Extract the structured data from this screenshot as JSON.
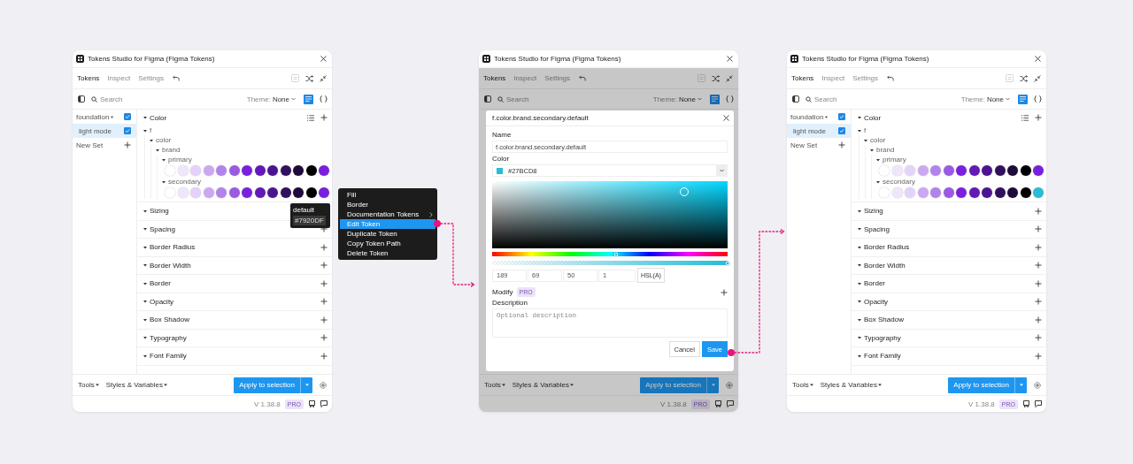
{
  "panels": [
    {
      "title": "Tokens Studio for Figma (Figma Tokens)",
      "dimmed": false,
      "tabs": [
        {
          "label": "Tokens",
          "selected": true
        },
        {
          "label": "Inspect",
          "selected": false
        },
        {
          "label": "Settings",
          "selected": false
        }
      ],
      "search": {
        "placeholder": "Search"
      },
      "theme": {
        "label": "Theme:",
        "value": "None"
      },
      "sets": [
        {
          "name": "foundation",
          "kind": "folder",
          "selected": false,
          "checked": true
        },
        {
          "name": "light mode",
          "kind": "set",
          "selected": true,
          "checked": true
        }
      ],
      "new_set": "New Set",
      "token_groups": [
        {
          "name": "Color",
          "tree": [
            {
              "name": "f",
              "children": [
                {
                  "name": "color",
                  "children": [
                    {
                      "name": "brand",
                      "children": [
                        {
                          "name": "primary",
                          "swatches": [
                            {
                              "color": "#ffffff"
                            },
                            {
                              "color": "#f0e6fc"
                            },
                            {
                              "color": "#e3d3f9"
                            },
                            {
                              "color": "#cca8f1"
                            },
                            {
                              "color": "#b283ea"
                            },
                            {
                              "color": "#9a5be2"
                            },
                            {
                              "color": "#7920df"
                            },
                            {
                              "color": "#6219b8"
                            },
                            {
                              "color": "#4c1590"
                            },
                            {
                              "color": "#32105e"
                            },
                            {
                              "color": "#1f0b3a"
                            },
                            {
                              "color": "#000000"
                            },
                            {
                              "color": "#7920df"
                            }
                          ]
                        },
                        {
                          "name": "secondary",
                          "swatches": [
                            {
                              "color": "#ffffff"
                            },
                            {
                              "color": "#f0e6fc"
                            },
                            {
                              "color": "#e3d3f9"
                            },
                            {
                              "color": "#cca8f1"
                            },
                            {
                              "color": "#b283ea"
                            },
                            {
                              "color": "#9a5be2"
                            },
                            {
                              "color": "#7920df"
                            },
                            {
                              "color": "#6219b8"
                            },
                            {
                              "color": "#4c1590"
                            },
                            {
                              "color": "#32105e"
                            },
                            {
                              "color": "#1f0b3a"
                            },
                            {
                              "color": "#000000"
                            },
                            {
                              "color": "#7920df"
                            }
                          ]
                        }
                      ]
                    }
                  ]
                }
              ]
            }
          ]
        },
        {
          "name": "Sizing"
        },
        {
          "name": "Spacing"
        },
        {
          "name": "Border Radius"
        },
        {
          "name": "Border Width"
        },
        {
          "name": "Border"
        },
        {
          "name": "Opacity"
        },
        {
          "name": "Box Shadow"
        },
        {
          "name": "Typography"
        },
        {
          "name": "Font Family"
        }
      ],
      "tooltip": {
        "title": "default",
        "value": "#7920DF"
      },
      "footer": {
        "menus": [
          "Tools",
          "Styles & Variables"
        ],
        "apply_button": "Apply to selection"
      },
      "status": {
        "version": "V 1.38.8",
        "badge": "PRO"
      }
    },
    {
      "title": "Tokens Studio for Figma (Figma Tokens)",
      "dimmed": true,
      "tabs": [
        {
          "label": "Tokens",
          "selected": true
        },
        {
          "label": "Inspect",
          "selected": false
        },
        {
          "label": "Settings",
          "selected": false
        }
      ],
      "search": {
        "placeholder": "Search"
      },
      "theme": {
        "label": "Theme:",
        "value": "None"
      },
      "footer": {
        "menus": [
          "Tools",
          "Styles & Variables"
        ],
        "apply_button": "Apply to selection"
      },
      "status": {
        "version": "V 1.38.8",
        "badge": "PRO"
      },
      "modal": {
        "title": "f.color.brand.secondary.default",
        "name_label": "Name",
        "name_value": "f.color.brand.secondary.default",
        "color_label": "Color",
        "color_value": "#27BCD8",
        "hue_slider": {
          "level": 0.525
        },
        "alpha_slider": {
          "level": 1
        },
        "channels": [
          "189",
          "69",
          "50",
          "1"
        ],
        "format_button": "HSL(A)",
        "modify_label": "Modify",
        "modify_badge": "PRO",
        "description": {
          "label": "Description",
          "placeholder": "Optional description"
        },
        "buttons": [
          {
            "label": "Cancel",
            "kind": "secondary"
          },
          {
            "label": "Save",
            "kind": "primary"
          }
        ]
      }
    },
    {
      "title": "Tokens Studio for Figma (Figma Tokens)",
      "dimmed": false,
      "tabs": [
        {
          "label": "Tokens",
          "selected": true
        },
        {
          "label": "Inspect",
          "selected": false
        },
        {
          "label": "Settings",
          "selected": false
        }
      ],
      "search": {
        "placeholder": "Search"
      },
      "theme": {
        "label": "Theme:",
        "value": "None"
      },
      "sets": [
        {
          "name": "foundation",
          "kind": "folder",
          "selected": false,
          "checked": true
        },
        {
          "name": "light mode",
          "kind": "set",
          "selected": true,
          "checked": true
        }
      ],
      "new_set": "New Set",
      "token_groups": [
        {
          "name": "Color",
          "tree": [
            {
              "name": "f",
              "children": [
                {
                  "name": "color",
                  "children": [
                    {
                      "name": "brand",
                      "children": [
                        {
                          "name": "primary",
                          "swatches": [
                            {
                              "color": "#ffffff"
                            },
                            {
                              "color": "#f0e6fc"
                            },
                            {
                              "color": "#e3d3f9"
                            },
                            {
                              "color": "#cca8f1"
                            },
                            {
                              "color": "#b283ea"
                            },
                            {
                              "color": "#9a5be2"
                            },
                            {
                              "color": "#7920df"
                            },
                            {
                              "color": "#6219b8"
                            },
                            {
                              "color": "#4c1590"
                            },
                            {
                              "color": "#32105e"
                            },
                            {
                              "color": "#1f0b3a"
                            },
                            {
                              "color": "#000000"
                            },
                            {
                              "color": "#7920df"
                            }
                          ]
                        },
                        {
                          "name": "secondary",
                          "swatches": [
                            {
                              "color": "#ffffff"
                            },
                            {
                              "color": "#f0e6fc"
                            },
                            {
                              "color": "#e3d3f9"
                            },
                            {
                              "color": "#cca8f1"
                            },
                            {
                              "color": "#b283ea"
                            },
                            {
                              "color": "#9a5be2"
                            },
                            {
                              "color": "#7920df"
                            },
                            {
                              "color": "#6219b8"
                            },
                            {
                              "color": "#4c1590"
                            },
                            {
                              "color": "#32105e"
                            },
                            {
                              "color": "#1f0b3a"
                            },
                            {
                              "color": "#000000"
                            },
                            {
                              "color": "#27bcd8"
                            }
                          ]
                        }
                      ]
                    }
                  ]
                }
              ]
            }
          ]
        },
        {
          "name": "Sizing"
        },
        {
          "name": "Spacing"
        },
        {
          "name": "Border Radius"
        },
        {
          "name": "Border Width"
        },
        {
          "name": "Border"
        },
        {
          "name": "Opacity"
        },
        {
          "name": "Box Shadow"
        },
        {
          "name": "Typography"
        },
        {
          "name": "Font Family"
        }
      ],
      "footer": {
        "menus": [
          "Tools",
          "Styles & Variables"
        ],
        "apply_button": "Apply to selection"
      },
      "status": {
        "version": "V 1.38.8",
        "badge": "PRO"
      }
    }
  ],
  "context_menu": {
    "items": [
      {
        "label": "Fill",
        "selected": false,
        "submenu": false
      },
      {
        "label": "Border",
        "selected": false,
        "submenu": false
      },
      {
        "label": "Documentation Tokens",
        "selected": false,
        "submenu": true
      },
      {
        "label": "Edit Token",
        "selected": true,
        "submenu": false
      },
      {
        "label": "Duplicate Token",
        "selected": false,
        "submenu": false
      },
      {
        "label": "Copy Token Path",
        "selected": false,
        "submenu": false
      },
      {
        "label": "Delete Token",
        "selected": false,
        "submenu": false
      }
    ]
  }
}
